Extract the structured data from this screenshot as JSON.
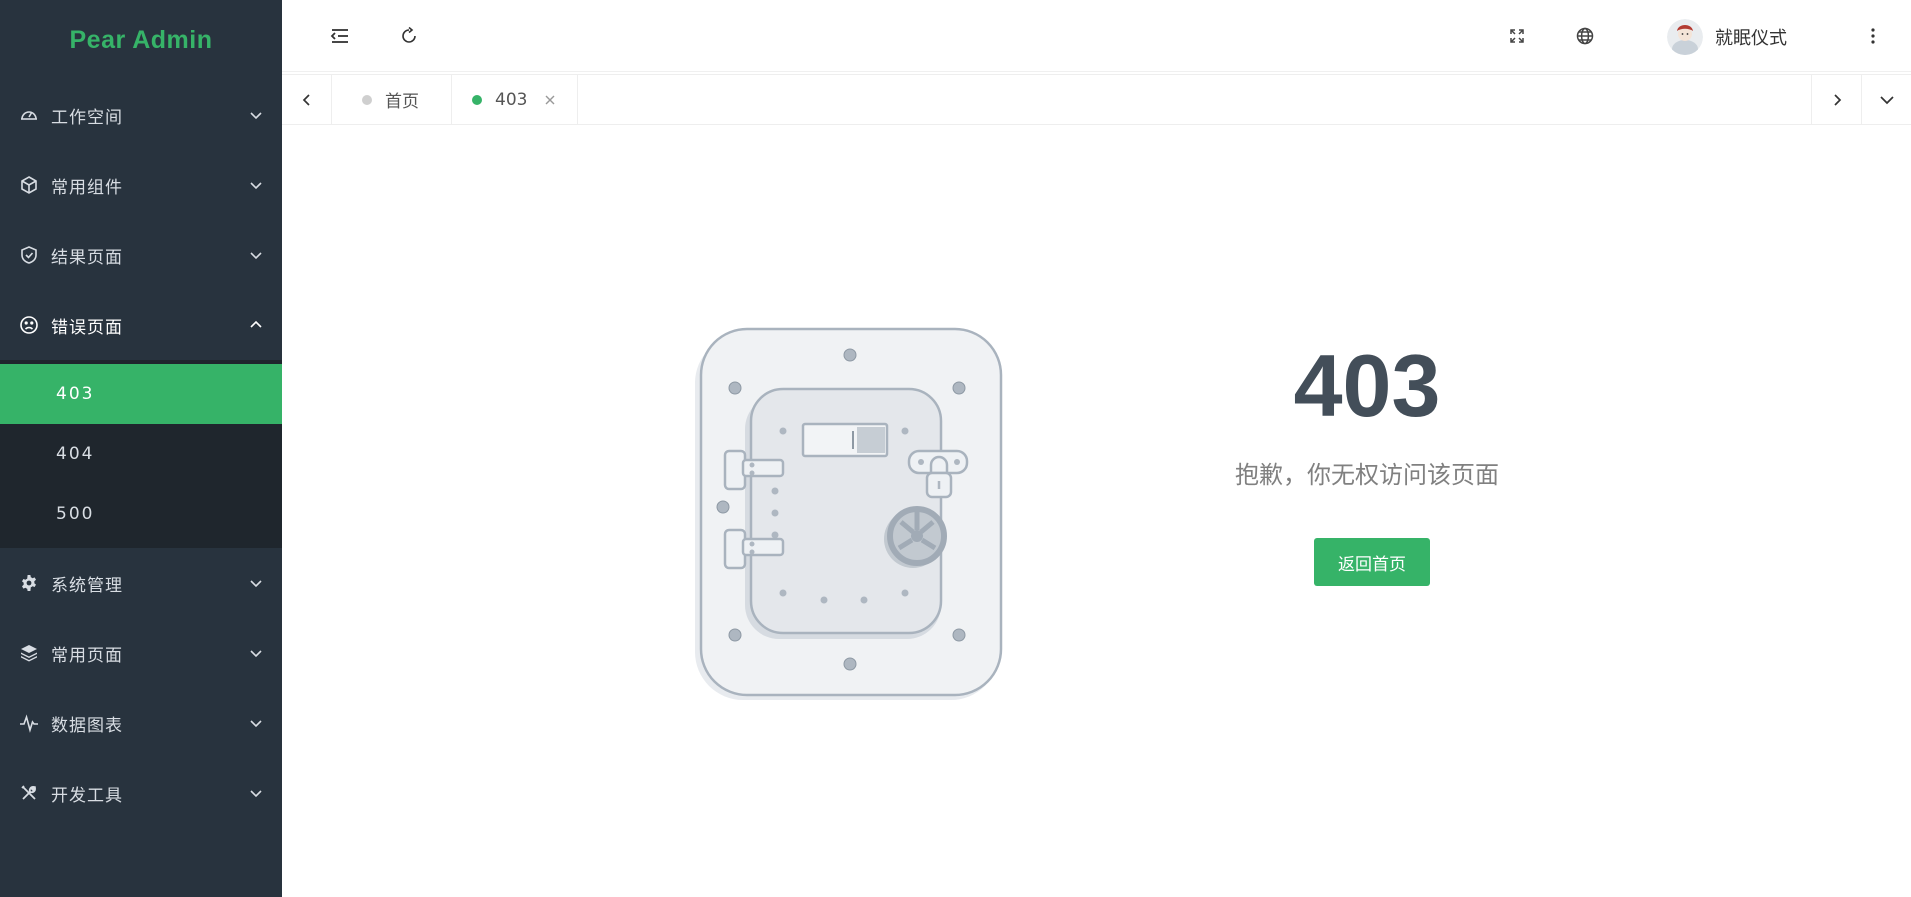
{
  "app": {
    "brand": "Pear Admin"
  },
  "sidebar": {
    "items": [
      {
        "label": "工作空间",
        "icon": "dashboard-icon"
      },
      {
        "label": "常用组件",
        "icon": "cube-icon"
      },
      {
        "label": "结果页面",
        "icon": "shield-check-icon"
      },
      {
        "label": "错误页面",
        "icon": "sad-face-icon",
        "expanded": true,
        "children": [
          {
            "label": "403",
            "active": true
          },
          {
            "label": "404"
          },
          {
            "label": "500"
          }
        ]
      },
      {
        "label": "系统管理",
        "icon": "gear-icon"
      },
      {
        "label": "常用页面",
        "icon": "layers-icon"
      },
      {
        "label": "数据图表",
        "icon": "pulse-icon"
      },
      {
        "label": "开发工具",
        "icon": "tools-icon"
      }
    ]
  },
  "header": {
    "icons": [
      "collapse-menu-icon",
      "refresh-icon",
      "fullscreen-icon",
      "globe-icon",
      "more-vertical-icon"
    ],
    "user_name": "就眠仪式"
  },
  "tabs": {
    "items": [
      {
        "label": "首页",
        "active": false
      },
      {
        "label": "403",
        "active": true
      }
    ]
  },
  "error": {
    "code": "403",
    "message": "抱歉，你无权访问该页面",
    "button_label": "返回首页"
  },
  "colors": {
    "sidebar_bg": "#28333e",
    "submenu_bg": "#1f262d",
    "accent": "#36b368",
    "title_text": "#434e59"
  }
}
